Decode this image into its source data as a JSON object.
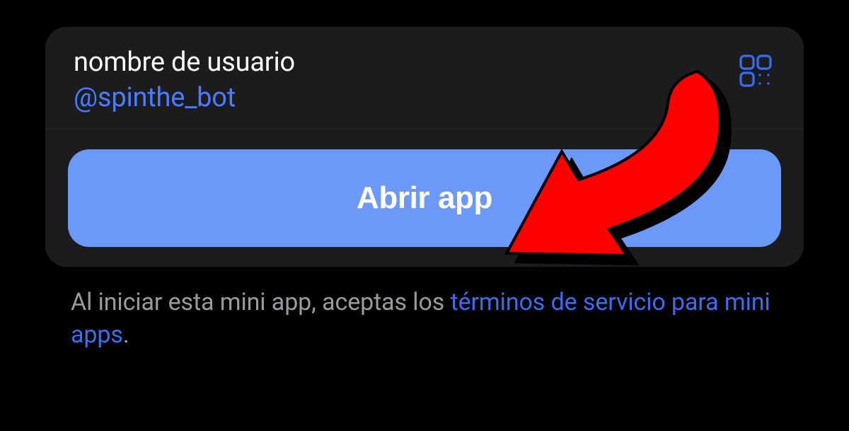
{
  "card": {
    "username_label": "nombre de usuario",
    "username_value": "@spinthe_bot",
    "open_button_label": "Abrir app"
  },
  "footer": {
    "prefix": "Al iniciar esta mini app, aceptas los ",
    "terms_link_text": "términos de servicio para mini apps",
    "suffix": "."
  },
  "colors": {
    "accent": "#3a6df0",
    "button": "#6c98f7",
    "card_bg": "#1c1c1e",
    "text_secondary": "#9a9aa0"
  },
  "icons": {
    "qr": "qr-code-icon",
    "annotation": "pointer-arrow"
  }
}
